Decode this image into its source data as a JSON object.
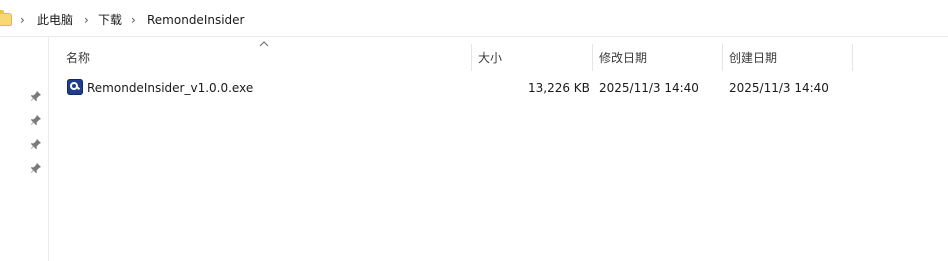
{
  "breadcrumb": {
    "items": [
      "此电脑",
      "下载",
      "RemondeInsider"
    ],
    "separator": "›"
  },
  "columns": {
    "name": "名称",
    "size": "大小",
    "modified": "修改日期",
    "created": "创建日期"
  },
  "files": [
    {
      "name": "RemondeInsider_v1.0.0.exe",
      "size": "13,226 KB",
      "modified": "2025/11/3 14:40",
      "created": "2025/11/3 14:40",
      "icon": "app-exe-icon"
    }
  ],
  "quick_access_pins": [
    "pin-icon",
    "pin-icon",
    "pin-icon",
    "pin-icon"
  ],
  "colors": {
    "folder": "#f8d775",
    "exe_icon": "#1f3e8a"
  }
}
